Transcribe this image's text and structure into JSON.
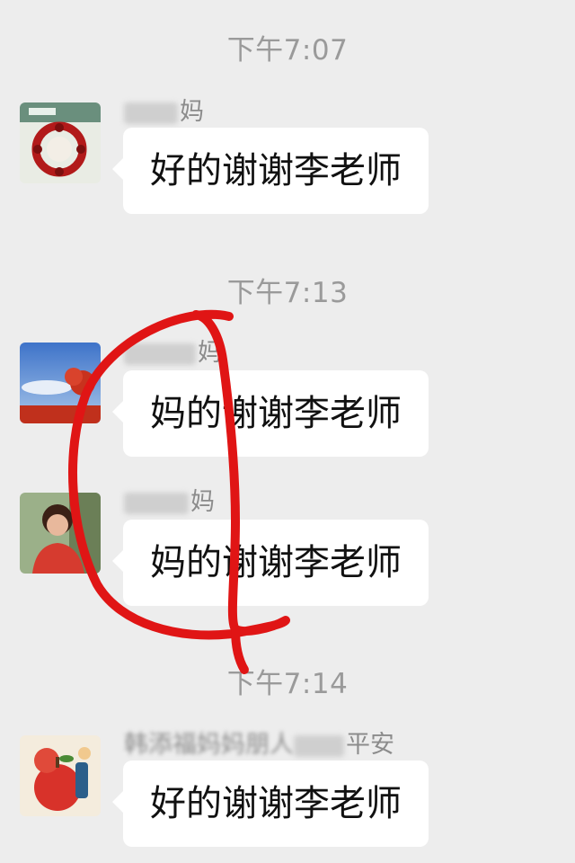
{
  "chat": {
    "timestamps": [
      "下午7:07",
      "下午7:13",
      "下午7:14"
    ],
    "messages": [
      {
        "sender_visible": "妈",
        "text": "好的谢谢李老师"
      },
      {
        "sender_visible": "妈",
        "text": "妈的谢谢李老师"
      },
      {
        "sender_visible": "妈",
        "text": "妈的谢谢李老师"
      },
      {
        "sender_visible": "韩添福妈妈朋人",
        "sender_suffix": "平安",
        "text": "好的谢谢李老师"
      }
    ]
  },
  "colors": {
    "background": "#ededed",
    "bubble": "#ffffff",
    "timestamp": "#9a9a9a",
    "annotation": "#e01515"
  }
}
